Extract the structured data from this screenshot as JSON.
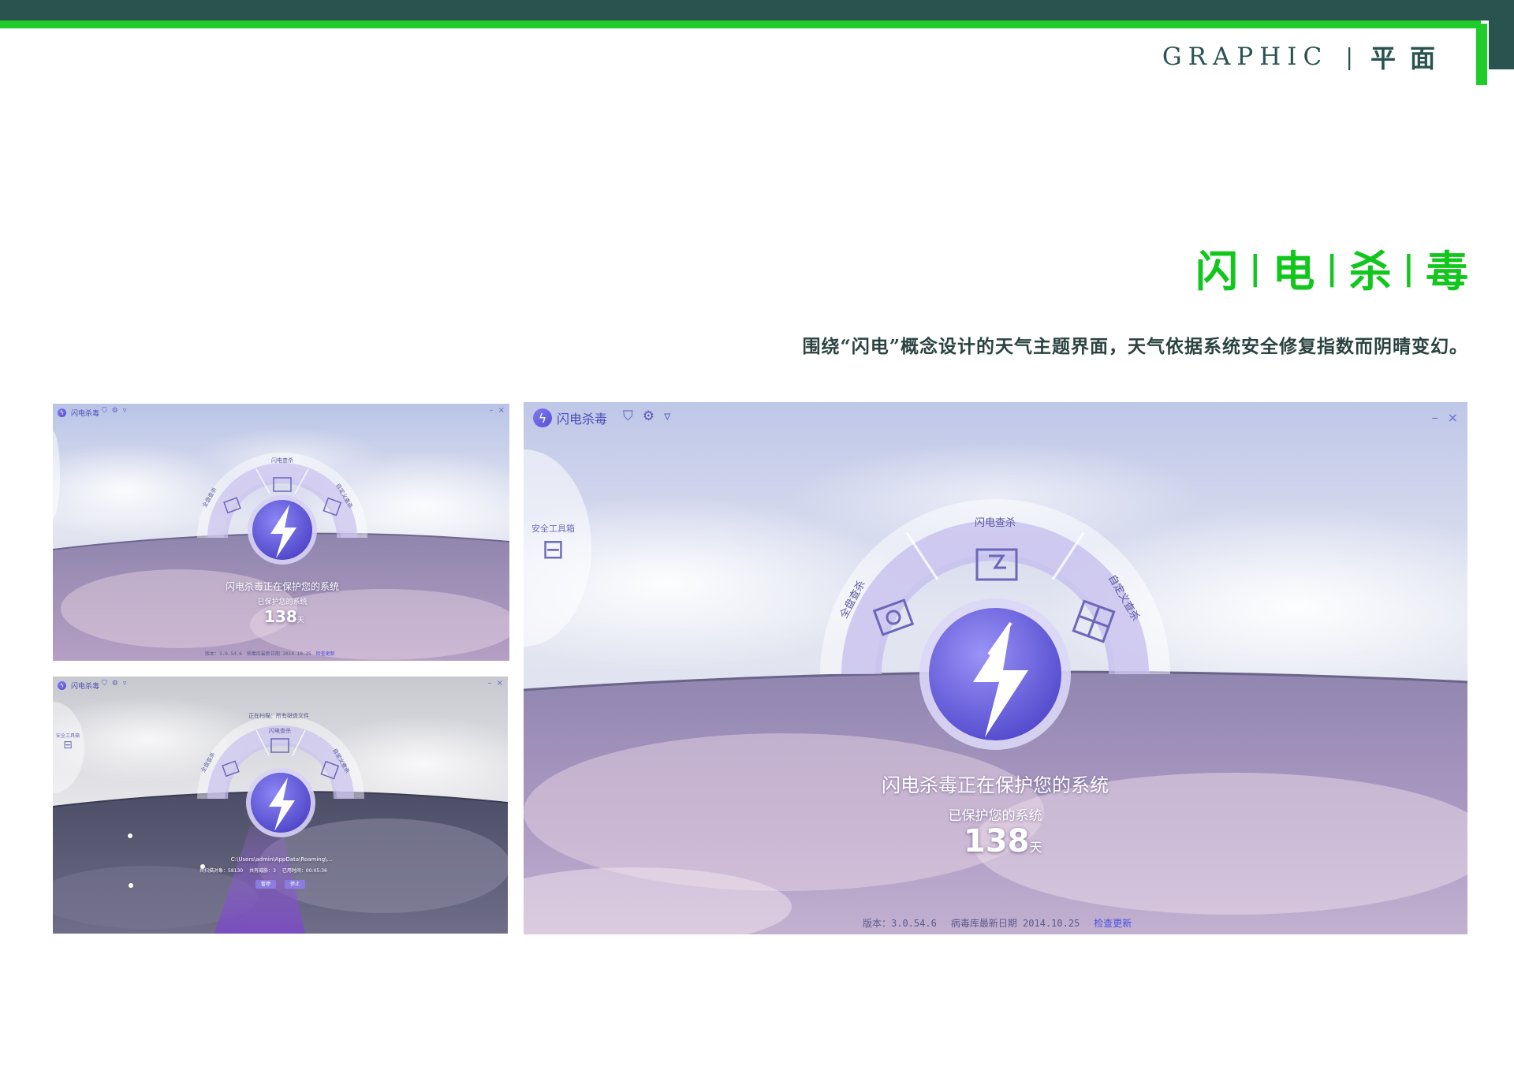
{
  "header": {
    "label_en": "GRAPHIC",
    "separator": "|",
    "label_cn": "平面"
  },
  "title": {
    "chars": [
      "闪",
      "电",
      "杀",
      "毒"
    ],
    "separator": "|"
  },
  "subtitle": "围绕“闪电”概念设计的天气主题界面，天气依据系统安全修复指数而阴晴变幻。",
  "app": {
    "name": "闪电杀毒",
    "toolbox": "安全工具箱",
    "segments": {
      "top": "闪电查杀",
      "left": "全盘查杀",
      "right": "自定义查杀"
    },
    "status_main": "闪电杀毒正在保护您的系统",
    "status_sub": "已保护您的系统",
    "days": "138",
    "days_unit": "天",
    "footer_version": "版本：3.0.54.6",
    "footer_db": "病毒库最新日期 2014.10.25",
    "footer_link": "检查更新",
    "win_min": "–",
    "win_close": "×"
  },
  "scan": {
    "title": "正在扫描：所有磁盘文件",
    "path": "C:\\Users\\admin\\AppData\\Roaming\\...",
    "stat_scanned": "共扫描对象：58130",
    "stat_found": "共有威胁：3",
    "stat_time": "已用时间：00:05:36",
    "btn_pause": "暂停",
    "btn_stop": "停止"
  },
  "colors": {
    "brand_green": "#12c71c",
    "dark_teal": "#2a5350",
    "accent_purple": "#6e66e8"
  }
}
